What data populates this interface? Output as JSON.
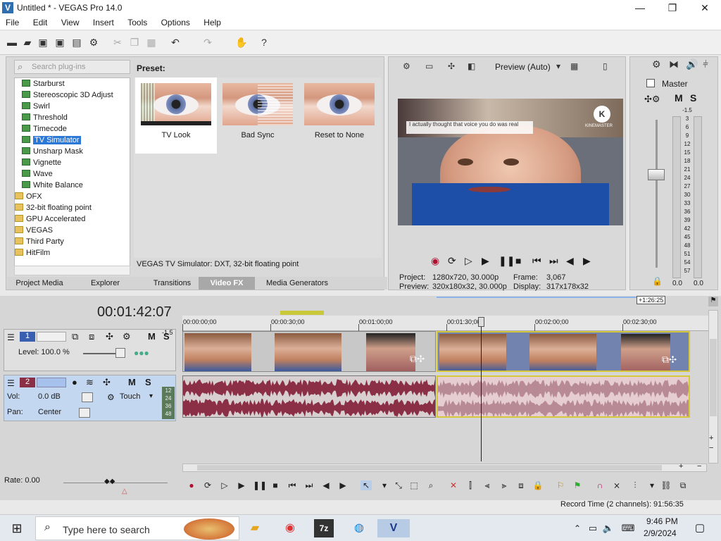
{
  "window": {
    "title": "Untitled * - VEGAS Pro 14.0",
    "minimize": "—",
    "maximize": "❐",
    "close": "✕"
  },
  "menu": [
    "File",
    "Edit",
    "View",
    "Insert",
    "Tools",
    "Options",
    "Help"
  ],
  "plugins": {
    "search_placeholder": "Search plug-ins",
    "items": [
      "Starburst",
      "Stereoscopic 3D Adjust",
      "Swirl",
      "Threshold",
      "Timecode",
      "TV Simulator",
      "Unsharp Mask",
      "Vignette",
      "Wave",
      "White Balance"
    ],
    "folders": [
      "OFX",
      "32-bit floating point",
      "GPU Accelerated",
      "VEGAS",
      "Third Party",
      "HitFilm"
    ],
    "selected": "TV Simulator"
  },
  "preset": {
    "label": "Preset:",
    "items": [
      "TV Look",
      "Bad Sync",
      "Reset to None"
    ],
    "description": "VEGAS TV Simulator: DXT, 32-bit floating point"
  },
  "tabs": [
    "Project Media",
    "Explorer",
    "Transitions",
    "Video FX",
    "Media Generators"
  ],
  "active_tab": "Video FX",
  "preview": {
    "mode": "Preview (Auto)",
    "overlay_text": "I actually thought that voice you do was real",
    "watermark": "KINEMASTER",
    "project_label": "Project:",
    "project_value": "1280x720, 30.000p",
    "preview_label": "Preview:",
    "preview_value": "320x180x32, 30.000p",
    "frame_label": "Frame:",
    "frame_value": "3,067",
    "display_label": "Display:",
    "display_value": "317x178x32"
  },
  "master": {
    "label": "Master",
    "m": "M",
    "s": "S",
    "scale": [
      "-1.5",
      "3",
      "6",
      "9",
      "12",
      "15",
      "18",
      "21",
      "24",
      "27",
      "30",
      "33",
      "36",
      "39",
      "42",
      "45",
      "48",
      "51",
      "54",
      "57"
    ],
    "readout_l": "0.0",
    "readout_r": "0.0"
  },
  "timeline": {
    "timecode": "00:01:42:07",
    "marker_end": "+1:26:25",
    "ruler": [
      "00:00:00;00",
      "00:00:30;00",
      "00:01:00;00",
      "00:01:30;00",
      "00:02:00;00",
      "00:02:30;00"
    ],
    "track1": {
      "num": "1",
      "level_label": "Level: 100.0 %",
      "m": "M",
      "s": "S",
      "peak": "-1.5"
    },
    "track2": {
      "num": "2",
      "vol_label": "Vol:",
      "vol_value": "0.0 dB",
      "pan_label": "Pan:",
      "pan_value": "Center",
      "mode": "Touch",
      "m": "M",
      "s": "S",
      "meter": [
        "12",
        "24",
        "36",
        "48"
      ]
    },
    "rate": "Rate: 0.00",
    "record_time": "Record Time (2 channels): 91:56:35"
  },
  "taskbar": {
    "search_placeholder": "Type here to search",
    "time": "9:46 PM",
    "date": "2/9/2024"
  },
  "colors": {
    "accent": "#2b78d6",
    "audio_clip": "#8a2f45",
    "audio_selected": "#c9a2a8",
    "timeline_bg": "#d6d6d6"
  }
}
